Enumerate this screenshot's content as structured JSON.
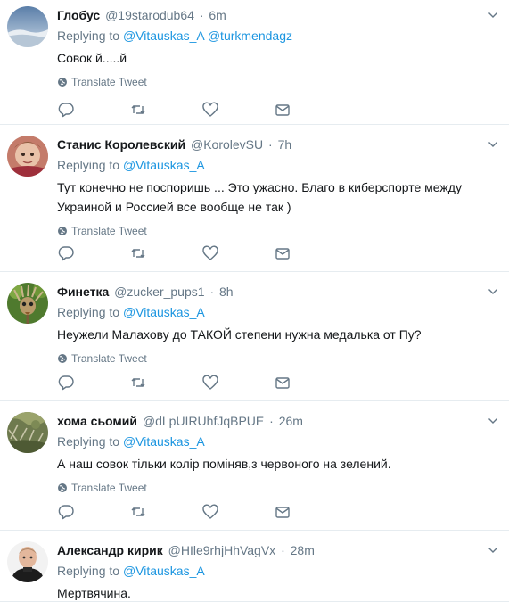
{
  "ui": {
    "replying_prefix": "Replying to",
    "translate_label": "Translate Tweet"
  },
  "tweets": [
    {
      "fullname": "Глобус",
      "username": "@19starodub64",
      "time": "6m",
      "reply_to": [
        "@Vitauskas_A",
        "@turkmendagz"
      ],
      "text": "Совок й.....й"
    },
    {
      "fullname": "Станис Королевский",
      "username": "@KorolevSU",
      "time": "7h",
      "reply_to": [
        "@Vitauskas_A"
      ],
      "text": "Тут конечно не поспоришь ... Это ужасно. Благо в киберспорте между Украиной и Россией все вообще не так )"
    },
    {
      "fullname": "Финетка",
      "username": "@zucker_pups1",
      "time": "8h",
      "reply_to": [
        "@Vitauskas_A"
      ],
      "text": "Неужели Малахову до ТАКОЙ степени нужна медалька от Пу?"
    },
    {
      "fullname": "хома сьомий",
      "username": "@dLpUIRUhfJqBPUE",
      "time": "26m",
      "reply_to": [
        "@Vitauskas_A"
      ],
      "text": "А наш совок тільки колір поміняв,з червоного на зелений."
    },
    {
      "fullname": "Александр кирик",
      "username": "@HIle9rhjHhVagVx",
      "time": "28m",
      "reply_to": [
        "@Vitauskas_A"
      ],
      "text": "Мертвячина."
    }
  ],
  "colors": {
    "link": "#1b95e0",
    "secondary": "#657786",
    "divider": "#e6ecf0",
    "text": "#14171a"
  },
  "icons": [
    "chevron-down-icon",
    "globe-icon",
    "reply-icon",
    "retweet-icon",
    "like-icon",
    "direct-message-icon"
  ]
}
